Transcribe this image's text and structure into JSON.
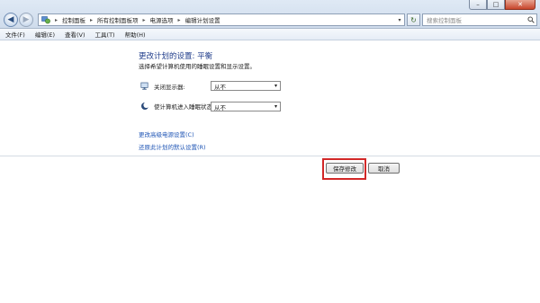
{
  "window": {
    "minimize_label": "–",
    "maximize_label": "□",
    "close_label": "✕"
  },
  "nav": {
    "back_glyph": "◀",
    "forward_glyph": "▶",
    "history_glyph": "▾"
  },
  "address": {
    "breadcrumb": [
      "控制面板",
      "所有控制面板项",
      "电源选项",
      "编辑计划设置"
    ],
    "separator": "▸",
    "dropdown_glyph": "▾"
  },
  "refresh_glyph": "↻",
  "search": {
    "placeholder": "搜索控制面板"
  },
  "menubar": {
    "items": [
      "文件(F)",
      "编辑(E)",
      "查看(V)",
      "工具(T)",
      "帮助(H)"
    ]
  },
  "main": {
    "title": "更改计划的设置: 平衡",
    "subtitle": "选择希望计算机使用的睡眠设置和显示设置。",
    "settings": [
      {
        "label": "关闭显示器:",
        "value": "从不",
        "icon": "monitor-icon"
      },
      {
        "label": "使计算机进入睡眠状态:",
        "value": "从不",
        "icon": "moon-icon"
      }
    ],
    "links": {
      "advanced": "更改高级电源设置(C)",
      "restore": "还原此计划的默认设置(R)"
    },
    "buttons": {
      "save": "保存修改",
      "cancel": "取消"
    }
  },
  "colors": {
    "heading": "#1e3b8a",
    "link": "#1f55b5",
    "highlight_box": "#d22828"
  }
}
